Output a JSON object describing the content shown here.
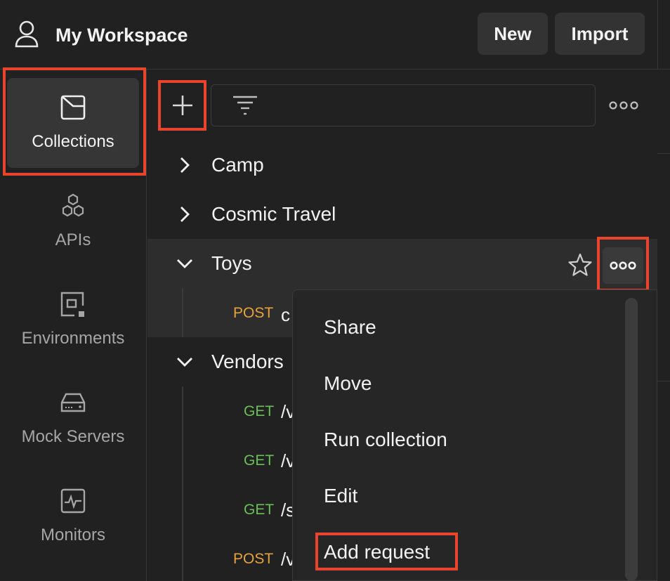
{
  "header": {
    "workspace_title": "My Workspace",
    "new_label": "New",
    "import_label": "Import",
    "user_icon": "user-icon"
  },
  "sidebar": {
    "items": [
      {
        "label": "Collections",
        "icon": "collection-icon",
        "active": true
      },
      {
        "label": "APIs",
        "icon": "apis-icon",
        "active": false
      },
      {
        "label": "Environments",
        "icon": "environment-icon",
        "active": false
      },
      {
        "label": "Mock Servers",
        "icon": "mock-server-icon",
        "active": false
      },
      {
        "label": "Monitors",
        "icon": "monitor-icon",
        "active": false
      }
    ]
  },
  "collections": {
    "items": [
      {
        "name": "Camp",
        "expanded": false
      },
      {
        "name": "Cosmic Travel",
        "expanded": false
      },
      {
        "name": "Toys",
        "expanded": true,
        "requests": [
          {
            "method": "POST",
            "path": "c"
          }
        ]
      },
      {
        "name": "Vendors",
        "expanded": true,
        "requests": [
          {
            "method": "GET",
            "path": "/v"
          },
          {
            "method": "GET",
            "path": "/v"
          },
          {
            "method": "GET",
            "path": "/s"
          },
          {
            "method": "POST",
            "path": "/v"
          }
        ]
      }
    ]
  },
  "context_menu": {
    "items": [
      "Share",
      "Move",
      "Run collection",
      "Edit",
      "Add request"
    ]
  },
  "colors": {
    "highlight": "#e8452c",
    "post": "#e6a23c",
    "get": "#6bbf59",
    "background": "#212121"
  }
}
